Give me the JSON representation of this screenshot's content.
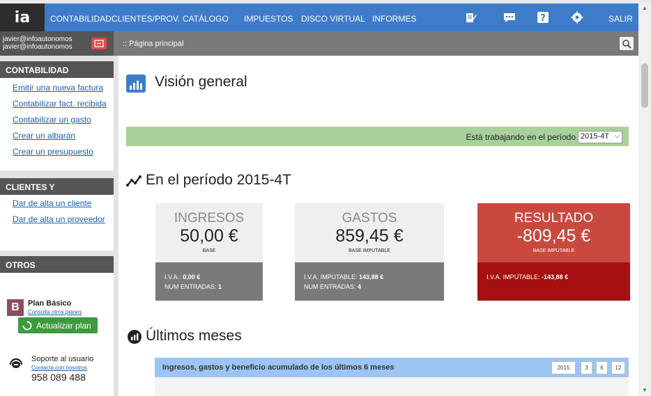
{
  "nav": {
    "logo": "ia",
    "items": [
      "CONTABILIDAD",
      "CLIENTES/PROV.",
      "CATÁLOGO",
      "IMPUESTOS",
      "DISCO VIRTUAL",
      "INFORMES"
    ],
    "exit": "SALIR"
  },
  "user": {
    "line1": "javier@infoautonomos",
    "line2": "javier@infoautonomos"
  },
  "breadcrumb": ":: Página principal",
  "sidebar": {
    "contabilidad": {
      "title": "CONTABILIDAD",
      "links": [
        "Emitir una nueva factura",
        "Contabilizar fact. recibida",
        "Contabilizar un gasto",
        "Crear un albarán",
        "Crear un presupuesto"
      ]
    },
    "clientes": {
      "title": "CLIENTES Y PROVEEDORES",
      "links": [
        "Dar de alta un cliente",
        "Dar de alta un proveedor"
      ]
    },
    "otros": {
      "title": "OTROS",
      "plan_badge": "B",
      "plan_name": "Plan Básico",
      "plan_link": "Consulta otros planes",
      "plan_button": "Actualizar plan",
      "support_title": "Soporte al usuario",
      "support_link": "Contacta con nosotros",
      "support_phone": "958 089 488"
    }
  },
  "main": {
    "title": "Visión general",
    "period_label": "Está trabajando en el período",
    "period_value": "2015-4T",
    "section_period": "En el período 2015-4T",
    "section_months": "Últimos meses",
    "cards": [
      {
        "title": "INGRESOS",
        "value": "50,00 €",
        "sub": "BASE",
        "l1_label": "I.V.A.:",
        "l1_value": "0,00 €",
        "l2_label": "NUM ENTRADAS:",
        "l2_value": "1"
      },
      {
        "title": "GASTOS",
        "value": "859,45 €",
        "sub": "BASE IMPUTABLE",
        "l1_label": "I.V.A. IMPUTABLE:",
        "l1_value": "143,88 €",
        "l2_label": "NUM ENTRADAS:",
        "l2_value": "4"
      },
      {
        "title": "RESULTADO",
        "value": "-809,45 €",
        "sub": "BASE IMPUTABLE",
        "l1_label": "I.V.A. IMPUTABLE:",
        "l1_value": "-143,88 €"
      }
    ],
    "chart_panel_title": "Ingresos, gastos y beneficio acumulado de los últimos 6 meses",
    "range_buttons": [
      "2015",
      "3",
      "6",
      "12"
    ]
  },
  "colors": {
    "nav_blue": "#3d7cc9",
    "period_green": "#a8d19a",
    "result_red": "#c9493f",
    "result_dark_red": "#a50f0f",
    "plan_green": "#3e9a3e"
  }
}
